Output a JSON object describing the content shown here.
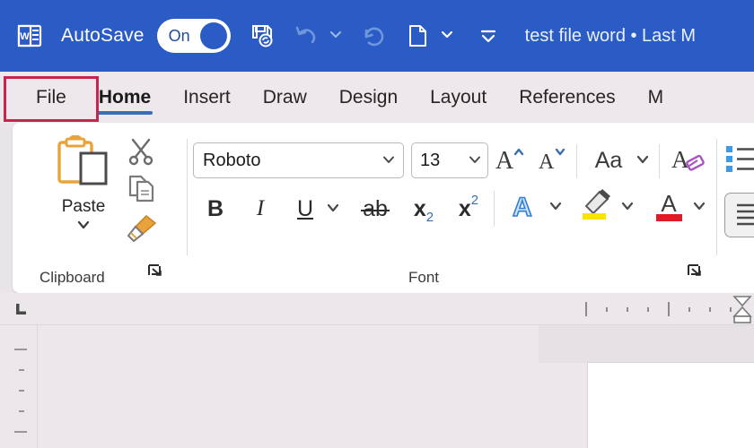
{
  "titlebar": {
    "app_icon": "word-logo-icon",
    "autosave_label": "AutoSave",
    "autosave_state": "On",
    "save_icon": "save-sync-icon",
    "undo_icon": "undo-icon",
    "undo_chevron": "chevron-down-icon",
    "redo_icon": "redo-icon",
    "new_doc_icon": "document-icon",
    "new_doc_chevron": "chevron-down-icon",
    "customize_icon": "customize-quick-access-icon",
    "document_title": "test file word • Last M",
    "bg_color": "#2B5BC4"
  },
  "tabs": [
    {
      "label": "File",
      "active": false,
      "highlighted": true
    },
    {
      "label": "Home",
      "active": true,
      "highlighted": false
    },
    {
      "label": "Insert",
      "active": false,
      "highlighted": false
    },
    {
      "label": "Draw",
      "active": false,
      "highlighted": false
    },
    {
      "label": "Design",
      "active": false,
      "highlighted": false
    },
    {
      "label": "Layout",
      "active": false,
      "highlighted": false
    },
    {
      "label": "References",
      "active": false,
      "highlighted": false
    },
    {
      "label": "M",
      "active": false,
      "highlighted": false
    }
  ],
  "highlight": {
    "color": "#C2284E",
    "target": "File"
  },
  "ribbon": {
    "clipboard": {
      "group_label": "Clipboard",
      "paste_label": "Paste",
      "paste_icon": "paste-clipboard-icon",
      "paste_chevron": "chevron-down-icon",
      "cut_icon": "scissors-icon",
      "copy_icon": "copy-icon",
      "format_painter_icon": "format-painter-brush-icon",
      "launcher_icon": "dialog-launcher-icon"
    },
    "font": {
      "group_label": "Font",
      "font_name": "Roboto",
      "font_name_chevron": "chevron-down-icon",
      "font_size": "13",
      "font_size_chevron": "chevron-down-icon",
      "grow_font_icon": "grow-font-icon",
      "shrink_font_icon": "shrink-font-icon",
      "change_case_label": "Aa",
      "change_case_chevron": "chevron-down-icon",
      "clear_formatting_icon": "clear-formatting-icon",
      "bold_label": "B",
      "italic_label": "I",
      "underline_label": "U",
      "underline_chevron": "chevron-down-icon",
      "strikethrough_label": "ab",
      "subscript_label": "x",
      "subscript_sub": "2",
      "superscript_label": "x",
      "superscript_sup": "2",
      "text_effects_label": "A",
      "text_effects_chevron": "chevron-down-icon",
      "highlight_icon": "text-highlight-icon",
      "highlight_chevron": "chevron-down-icon",
      "font_color_label": "A",
      "font_color_swatch": "#E01B24",
      "font_color_chevron": "chevron-down-icon",
      "launcher_icon": "dialog-launcher-icon"
    },
    "paragraph": {
      "bullets_icon": "bullet-list-icon",
      "align_icon": "align-left-icon"
    }
  },
  "document": {
    "tab_stop_icon": "tab-stop-left-icon",
    "ruler_horizontal": "horizontal-ruler",
    "ruler_vertical": "vertical-ruler",
    "indent_marker_icon": "indent-marker-icon",
    "page_background": "#ffffff"
  }
}
